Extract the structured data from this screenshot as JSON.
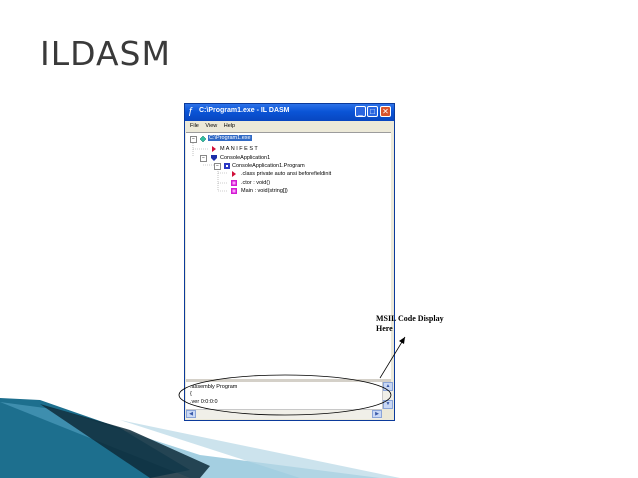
{
  "slide": {
    "title": "ILDASM"
  },
  "window": {
    "title": "C:\\Program1.exe - IL DASM",
    "menu": [
      "File",
      "View",
      "Help"
    ],
    "tree": [
      {
        "label": "C:\\Program1.exe",
        "icon": "diamond-icon"
      },
      {
        "label": "M A N I F E S T",
        "icon": "red-arrow-icon"
      },
      {
        "label": "ConsoleApplication1",
        "icon": "shield-icon"
      },
      {
        "label": "ConsoleApplication1.Program",
        "icon": "class-icon"
      },
      {
        "label": ".class private auto ansi beforefieldinit",
        "icon": "red-arrow-icon"
      },
      {
        "label": ".ctor : void()",
        "icon": "method-icon"
      },
      {
        "label": "Main : void(string[])",
        "icon": "method-icon"
      }
    ],
    "code_lines": [
      ".assembly Program",
      "{",
      ".ver 0:0:0:0"
    ]
  },
  "annotation": {
    "line1": "MSIL Code Display",
    "line2": "Here"
  },
  "colors": {
    "titlebar": "#0a54d6",
    "selection": "#316ac5",
    "accent_teal": "#1d6f8e"
  }
}
